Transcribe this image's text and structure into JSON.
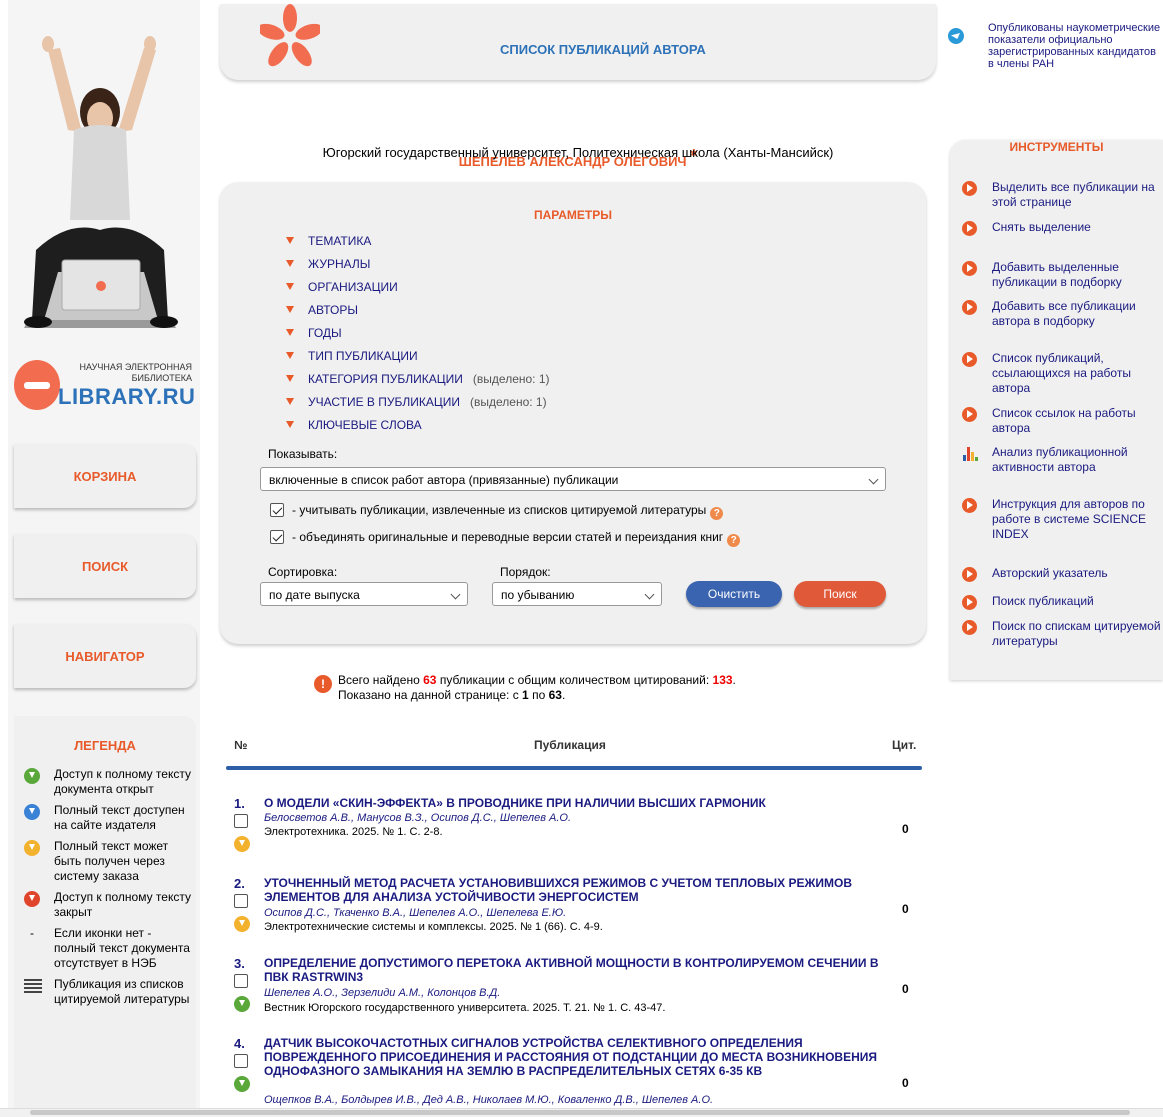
{
  "header": {
    "title": "СПИСОК ПУБЛИКАЦИЙ АВТОРА"
  },
  "logo": {
    "small_line1": "НАУЧНАЯ ЭЛЕКТРОННАЯ",
    "small_line2": "БИБЛИОТЕКА",
    "big": "LIBRARY.RU"
  },
  "sidebar": {
    "cart": "КОРЗИНА",
    "search": "ПОИСК",
    "navigator": "НАВИГАТОР"
  },
  "legend": {
    "title": "ЛЕГЕНДА",
    "items": [
      {
        "icon": "download-green-icon",
        "color": "#5aa83a",
        "text": "Доступ к полному тексту документа открыт"
      },
      {
        "icon": "download-blue-icon",
        "color": "#3a82d6",
        "text": "Полный текст доступен на сайте издателя"
      },
      {
        "icon": "download-yellow-icon",
        "color": "#f2b22e",
        "text": "Полный текст может быть получен через систему заказа"
      },
      {
        "icon": "download-red-icon",
        "color": "#e0452b",
        "text": "Доступ к полному тексту закрыт"
      },
      {
        "icon": "dash",
        "text": "Если иконки нет - полный текст документа отсутствует в НЭБ"
      },
      {
        "icon": "list-icon",
        "text": "Публикация из списков цитируемой литературы"
      }
    ]
  },
  "author": {
    "name": "ШЕПЕЛЕВ АЛЕКСАНДР ОЛЕГОВИЧ",
    "star": "*",
    "affiliation": "Югорский государственный университет, Политехническая школа (Ханты-Мансийск)"
  },
  "params": {
    "title": "ПАРАМЕТРЫ",
    "items": [
      {
        "label": "ТЕМАТИКА",
        "note": ""
      },
      {
        "label": "ЖУРНАЛЫ",
        "note": ""
      },
      {
        "label": "ОРГАНИЗАЦИИ",
        "note": ""
      },
      {
        "label": "АВТОРЫ",
        "note": ""
      },
      {
        "label": "ГОДЫ",
        "note": ""
      },
      {
        "label": "ТИП ПУБЛИКАЦИИ",
        "note": ""
      },
      {
        "label": "КАТЕГОРИЯ ПУБЛИКАЦИИ",
        "note": "(выделено: 1)"
      },
      {
        "label": "УЧАСТИЕ В ПУБЛИКАЦИИ",
        "note": "(выделено: 1)"
      },
      {
        "label": "КЛЮЧЕВЫЕ СЛОВА",
        "note": ""
      }
    ],
    "show_label": "Показывать:",
    "show_value": "включенные в список работ автора (привязанные) публикации",
    "checkbox1": "- учитывать публикации, извлеченные из списков цитируемой литературы",
    "checkbox2": "- объединять оригинальные и переводные версии статей и переиздания книг",
    "sort_label": "Сортировка:",
    "sort_value": "по дате выпуска",
    "order_label": "Порядок:",
    "order_value": "по убыванию",
    "clear_button": "Очистить",
    "search_button": "Поиск",
    "help_glyph": "?"
  },
  "summary": {
    "prefix": "Всего найдено",
    "count": "63",
    "middle": "публикации с общим количеством цитирований:",
    "citations": "133",
    "end": ".",
    "line2_prefix": "Показано на данной странице: с",
    "from": "1",
    "to_word": "по",
    "to": "63",
    "line2_end": "."
  },
  "table": {
    "col_num": "№",
    "col_pub": "Публикация",
    "col_cit": "Цит.",
    "rows": [
      {
        "num": "1.",
        "title": "О МОДЕЛИ «СКИН-ЭФФЕКТА» В ПРОВОДНИКЕ ПРИ НАЛИЧИИ ВЫСШИХ ГАРМОНИК",
        "authors": "Белосветов А.В., Манусов В.З., Осипов Д.С., Шепелев А.О.",
        "source": "Электротехника. 2025. № 1. С. 2-8.",
        "cit": "0",
        "dl_color": "#f2b22e"
      },
      {
        "num": "2.",
        "title": "УТОЧНЕННЫЙ МЕТОД РАСЧЕТА УСТАНОВИВШИХСЯ РЕЖИМОВ С УЧЕТОМ ТЕПЛОВЫХ РЕЖИМОВ ЭЛЕМЕНТОВ ДЛЯ АНАЛИЗА УСТОЙЧИВОСТИ ЭНЕРГОСИСТЕМ",
        "authors": "Осипов Д.С., Ткаченко В.А., Шепелев А.О., Шепелева Е.Ю.",
        "source": "Электротехнические системы и комплексы. 2025. № 1 (66). С. 4-9.",
        "cit": "0",
        "dl_color": "#f2b22e"
      },
      {
        "num": "3.",
        "title": "ОПРЕДЕЛЕНИЕ ДОПУСТИМОГО ПЕРЕТОКА АКТИВНОЙ МОЩНОСТИ В КОНТРОЛИРУЕМОМ СЕЧЕНИИ В ПВК RASTRWIN3",
        "authors": "Шепелев А.О., Зерзелиди А.М., Колонцов В.Д.",
        "source": "Вестник Югорского государственного университета. 2025. Т. 21. № 1. С. 43-47.",
        "cit": "0",
        "dl_color": "#5aa83a"
      },
      {
        "num": "4.",
        "title": "ДАТЧИК ВЫСОКОЧАСТОТНЫХ СИГНАЛОВ УСТРОЙСТВА СЕЛЕКТИВНОГО ОПРЕДЕЛЕНИЯ ПОВРЕЖДЕННОГО ПРИСОЕДИНЕНИЯ И РАССТОЯНИЯ ОТ ПОДСТАНЦИИ ДО МЕСТА ВОЗНИКНОВЕНИЯ ОДНОФАЗНОГО ЗАМЫКАНИЯ НА ЗЕМЛЮ В РАСПРЕДЕЛИТЕЛЬНЫХ СЕТЯХ 6-35 КВ",
        "authors": "Ощепков В.А., Болдырев И.В., Дед А.В., Николаев М.Ю., Коваленко Д.В., Шепелев А.О.",
        "source": "",
        "cit": "0",
        "dl_color": "#5aa83a"
      }
    ]
  },
  "right": {
    "notice": "Опубликованы наукометрические показатели официально зарегистрированных кандидатов в члены РАН",
    "tools_title": "ИНСТРУМЕНТЫ",
    "tools": [
      "Выделить все публикации на этой странице",
      "Снять выделение",
      "Добавить выделенные публикации в подборку",
      "Добавить все публикации автора в подборку",
      "Список публикаций, ссылающихся на работы автора",
      "Список ссылок на работы автора",
      "Анализ публикационной активности автора",
      "Инструкция для авторов по работе в системе SCIENCE INDEX",
      "Авторский указатель",
      "Поиск публикаций",
      "Поиск по спискам цитируемой литературы"
    ]
  }
}
